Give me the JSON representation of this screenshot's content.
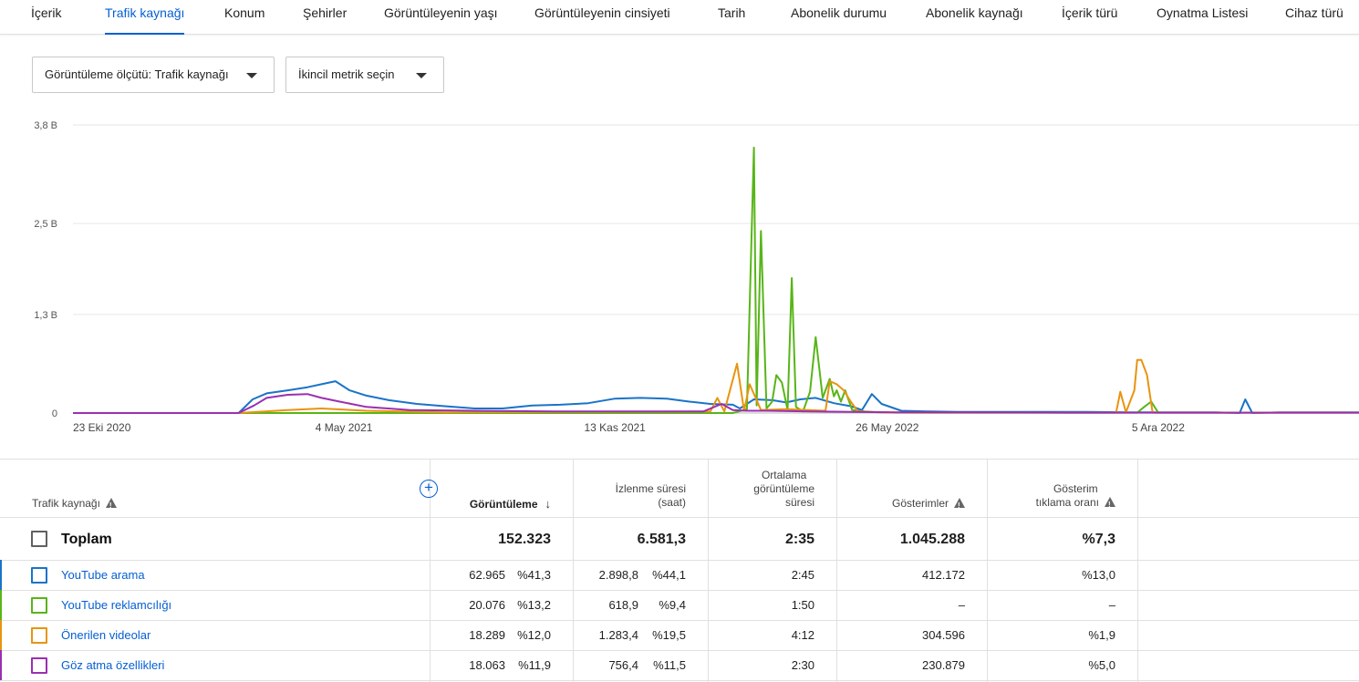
{
  "tabs": [
    {
      "label": "İçerik",
      "active": false
    },
    {
      "label": "Trafik kaynağı",
      "active": true
    },
    {
      "label": "Konum",
      "active": false
    },
    {
      "label": "Şehirler",
      "active": false
    },
    {
      "label": "Görüntüleyenin yaşı",
      "active": false
    },
    {
      "label": "Görüntüleyenin cinsiyeti",
      "active": false
    },
    {
      "label": "Tarih",
      "active": false
    },
    {
      "label": "Abonelik durumu",
      "active": false
    },
    {
      "label": "Abonelik kaynağı",
      "active": false
    },
    {
      "label": "İçerik türü",
      "active": false
    },
    {
      "label": "Oynatma Listesi",
      "active": false
    },
    {
      "label": "Cihaz türü",
      "active": false
    }
  ],
  "controls": {
    "metric_dropdown": "Görüntüleme ölçütü: Trafik kaynağı",
    "secondary_dropdown": "İkincil metrik seçin"
  },
  "chart_data": {
    "type": "line",
    "title": "",
    "xlabel": "",
    "ylabel": "",
    "y_tick_labels": [
      "0",
      "1,3 B",
      "2,5 B",
      "3,8 B"
    ],
    "y_ticks": [
      0,
      1300,
      2500,
      3800
    ],
    "ylim": [
      0,
      3800
    ],
    "x_tick_labels": [
      "23 Eki 2020",
      "4 May 2021",
      "13 Kas 2021",
      "26 May 2022",
      "5 Ara 2022"
    ],
    "x_ticks": [
      "2020-10-23",
      "2021-05-04",
      "2021-11-13",
      "2022-05-26",
      "2022-12-05"
    ],
    "xlim": [
      "2020-10-23",
      "2023-04-27"
    ],
    "grid": true,
    "legend": "none",
    "series": [
      {
        "name": "YouTube arama",
        "color": "#1a73c8",
        "x": [
          "2020-10-23",
          "2021-02-18",
          "2021-02-28",
          "2021-03-10",
          "2021-03-25",
          "2021-04-08",
          "2021-04-18",
          "2021-04-28",
          "2021-05-08",
          "2021-05-20",
          "2021-06-05",
          "2021-06-25",
          "2021-07-15",
          "2021-08-05",
          "2021-08-25",
          "2021-09-15",
          "2021-10-05",
          "2021-10-25",
          "2021-11-13",
          "2021-12-01",
          "2021-12-20",
          "2022-01-05",
          "2022-01-20",
          "2022-02-05",
          "2022-02-10",
          "2022-02-20",
          "2022-03-05",
          "2022-03-15",
          "2022-03-25",
          "2022-04-05",
          "2022-04-18",
          "2022-04-30",
          "2022-05-08",
          "2022-05-15",
          "2022-05-22",
          "2022-06-05",
          "2022-06-25",
          "2022-07-15",
          "2022-08-15",
          "2022-09-15",
          "2022-10-15",
          "2022-11-15",
          "2022-12-15",
          "2023-01-15",
          "2023-02-01",
          "2023-02-05",
          "2023-02-10",
          "2023-03-01",
          "2023-04-27"
        ],
        "y": [
          0,
          0,
          180,
          260,
          300,
          340,
          380,
          420,
          300,
          230,
          170,
          120,
          90,
          60,
          60,
          100,
          110,
          130,
          190,
          200,
          190,
          150,
          120,
          110,
          60,
          180,
          170,
          140,
          180,
          200,
          130,
          90,
          40,
          250,
          120,
          30,
          20,
          15,
          15,
          15,
          15,
          10,
          10,
          10,
          0,
          180,
          0,
          10,
          10
        ]
      },
      {
        "name": "YouTube reklamcılığı",
        "color": "#58b518",
        "x": [
          "2020-10-23",
          "2022-02-05",
          "2022-02-15",
          "2022-02-20",
          "2022-02-22",
          "2022-02-25",
          "2022-03-01",
          "2022-03-05",
          "2022-03-08",
          "2022-03-12",
          "2022-03-16",
          "2022-03-19",
          "2022-03-22",
          "2022-03-27",
          "2022-04-01",
          "2022-04-05",
          "2022-04-10",
          "2022-04-15",
          "2022-04-18",
          "2022-04-20",
          "2022-04-23",
          "2022-04-26",
          "2022-05-01",
          "2022-05-10",
          "2022-05-20",
          "2022-06-01",
          "2022-11-20",
          "2022-11-25",
          "2022-11-30",
          "2022-12-05",
          "2023-04-27"
        ],
        "y": [
          0,
          0,
          50,
          3500,
          100,
          2400,
          60,
          150,
          500,
          400,
          40,
          1780,
          80,
          20,
          280,
          1000,
          200,
          450,
          220,
          300,
          150,
          300,
          40,
          20,
          10,
          5,
          5,
          80,
          150,
          5,
          5
        ]
      },
      {
        "name": "Önerilen videolar",
        "color": "#e8940f",
        "x": [
          "2020-10-23",
          "2021-02-18",
          "2021-03-25",
          "2021-04-18",
          "2021-05-20",
          "2021-07-15",
          "2022-01-20",
          "2022-01-25",
          "2022-01-30",
          "2022-02-08",
          "2022-02-13",
          "2022-02-17",
          "2022-02-25",
          "2022-03-15",
          "2022-04-12",
          "2022-04-15",
          "2022-04-20",
          "2022-04-25",
          "2022-04-30",
          "2022-05-05",
          "2022-05-20",
          "2022-06-15",
          "2022-11-05",
          "2022-11-08",
          "2022-11-12",
          "2022-11-18",
          "2022-11-20",
          "2022-11-23",
          "2022-11-27",
          "2022-12-01",
          "2023-04-27"
        ],
        "y": [
          0,
          0,
          40,
          60,
          30,
          10,
          20,
          200,
          20,
          650,
          30,
          380,
          40,
          50,
          30,
          420,
          380,
          300,
          150,
          20,
          10,
          5,
          5,
          280,
          10,
          300,
          700,
          700,
          500,
          5,
          5
        ]
      },
      {
        "name": "Göz atma özellikleri",
        "color": "#9b2fb0",
        "x": [
          "2020-10-23",
          "2021-02-18",
          "2021-03-01",
          "2021-03-10",
          "2021-03-25",
          "2021-04-08",
          "2021-04-18",
          "2021-05-01",
          "2021-05-20",
          "2021-06-20",
          "2021-08-01",
          "2021-10-01",
          "2022-01-15",
          "2022-01-28",
          "2022-02-05",
          "2022-02-15",
          "2022-03-01",
          "2022-04-01",
          "2022-05-01",
          "2022-06-01",
          "2022-10-01",
          "2023-04-27"
        ],
        "y": [
          0,
          0,
          100,
          200,
          240,
          250,
          200,
          150,
          80,
          40,
          30,
          20,
          20,
          120,
          40,
          30,
          30,
          20,
          15,
          10,
          5,
          5
        ]
      }
    ]
  },
  "table": {
    "headers": {
      "source": "Trafik kaynağı",
      "views": "Görüntüleme",
      "watch_time": [
        "İzlenme süresi",
        "(saat)"
      ],
      "avg_duration": [
        "Ortalama",
        "görüntüleme",
        "süresi"
      ],
      "impressions": "Gösterimler",
      "ctr": [
        "Gösterim",
        "tıklama oranı"
      ]
    },
    "total": {
      "label": "Toplam",
      "views": "152.323",
      "watch_time": "6.581,3",
      "avg_duration": "2:35",
      "impressions": "1.045.288",
      "ctr": "%7,3"
    },
    "rows": [
      {
        "label": "YouTube arama",
        "color": "#1a73c8",
        "views": "62.965",
        "views_pct": "%41,3",
        "watch_time": "2.898,8",
        "watch_pct": "%44,1",
        "avg_duration": "2:45",
        "impressions": "412.172",
        "ctr": "%13,0"
      },
      {
        "label": "YouTube reklamcılığı",
        "color": "#58b518",
        "views": "20.076",
        "views_pct": "%13,2",
        "watch_time": "618,9",
        "watch_pct": "%9,4",
        "avg_duration": "1:50",
        "impressions": "–",
        "ctr": "–"
      },
      {
        "label": "Önerilen videolar",
        "color": "#e8940f",
        "views": "18.289",
        "views_pct": "%12,0",
        "watch_time": "1.283,4",
        "watch_pct": "%19,5",
        "avg_duration": "4:12",
        "impressions": "304.596",
        "ctr": "%1,9"
      },
      {
        "label": "Göz atma özellikleri",
        "color": "#9b2fb0",
        "views": "18.063",
        "views_pct": "%11,9",
        "watch_time": "756,4",
        "watch_pct": "%11,5",
        "avg_duration": "2:30",
        "impressions": "230.879",
        "ctr": "%5,0"
      }
    ]
  }
}
